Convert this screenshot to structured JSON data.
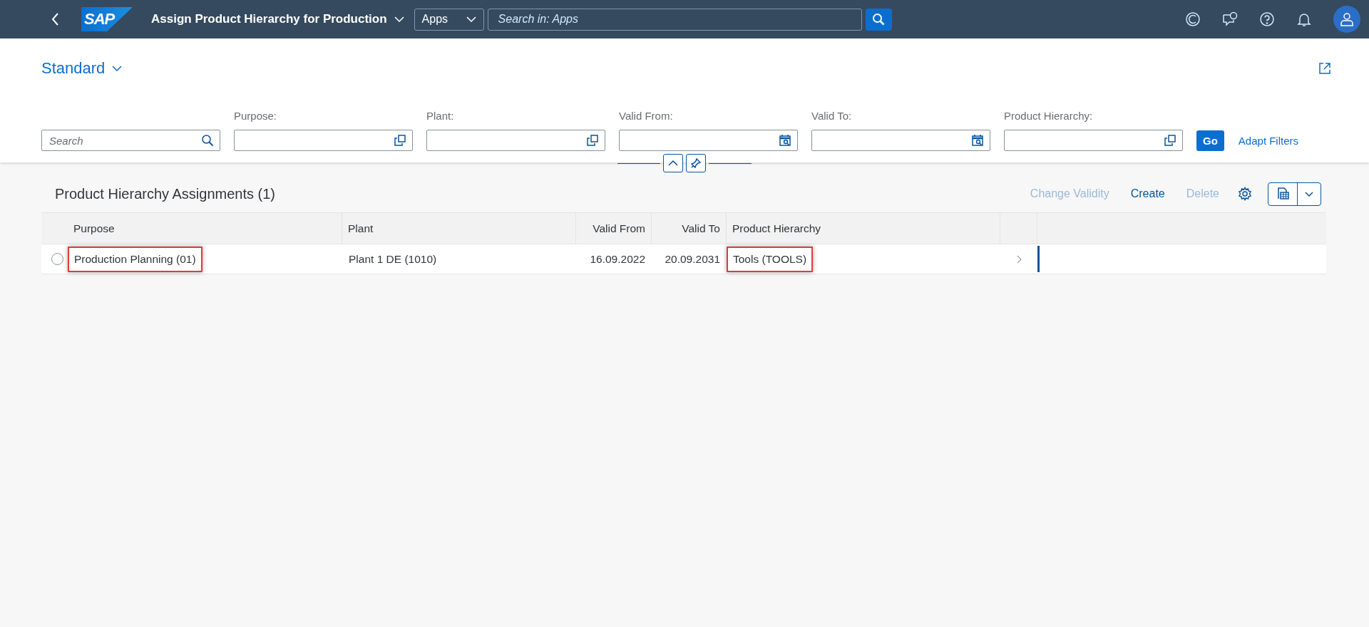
{
  "shell": {
    "logo": "SAP",
    "title": "Assign Product Hierarchy for Production",
    "scope": "Apps",
    "search": {
      "placeholder": "Search in: Apps"
    }
  },
  "variant": {
    "name": "Standard"
  },
  "filters": [
    {
      "kind": "search",
      "placeholder": "Search"
    },
    {
      "kind": "valuehelp",
      "label": "Purpose:"
    },
    {
      "kind": "valuehelp",
      "label": "Plant:"
    },
    {
      "kind": "date",
      "label": "Valid From:"
    },
    {
      "kind": "date",
      "label": "Valid To:"
    },
    {
      "kind": "valuehelp",
      "label": "Product Hierarchy:"
    }
  ],
  "filter_actions": {
    "go": "Go",
    "adapt": "Adapt Filters"
  },
  "table": {
    "title": "Product Hierarchy Assignments (1)",
    "actions": [
      {
        "label": "Change Validity",
        "disabled": true
      },
      {
        "label": "Create",
        "disabled": false
      },
      {
        "label": "Delete",
        "disabled": true
      }
    ],
    "columns": [
      {
        "label": "Purpose",
        "kind": "text"
      },
      {
        "label": "Plant",
        "kind": "text"
      },
      {
        "label": "Valid From",
        "kind": "date"
      },
      {
        "label": "Valid To",
        "kind": "date"
      },
      {
        "label": "Product Hierarchy",
        "kind": "text"
      }
    ],
    "rows": [
      {
        "selected": false,
        "cells": [
          "Production Planning (01)",
          "Plant 1 DE (1010)",
          "16.09.2022",
          "20.09.2031",
          "Tools (TOOLS)"
        ],
        "highlighted": [
          true,
          false,
          false,
          false,
          true
        ]
      }
    ]
  }
}
